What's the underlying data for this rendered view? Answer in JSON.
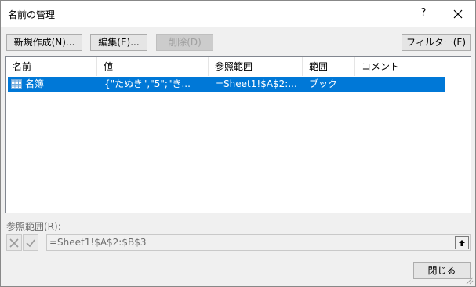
{
  "window": {
    "title": "名前の管理",
    "help_label": "?",
    "close_label": "✕"
  },
  "toolbar": {
    "new_label": "新規作成(N)...",
    "edit_label": "編集(E)...",
    "delete_label": "削除(D)",
    "filter_label": "フィルター(F)"
  },
  "table": {
    "headers": [
      "名前",
      "値",
      "参照範囲",
      "範囲",
      "コメント"
    ],
    "rows": [
      {
        "name": "名簿",
        "value": "{\"たぬき\",\"5\";\"き...",
        "refers_to": "=Sheet1!$A$2:...",
        "scope": "ブック",
        "comment": ""
      }
    ]
  },
  "refers_to": {
    "label": "参照範囲(R):",
    "value": "=Sheet1!$A$2:$B$3"
  },
  "footer": {
    "close_label": "閉じる"
  },
  "icons": {
    "table_icon": "table-grid-icon",
    "cancel_icon": "x-icon",
    "confirm_icon": "check-icon",
    "collapse_icon": "arrow-up-icon"
  },
  "colors": {
    "selection": "#0078d7",
    "dialog_bg": "#f0f0f0"
  }
}
